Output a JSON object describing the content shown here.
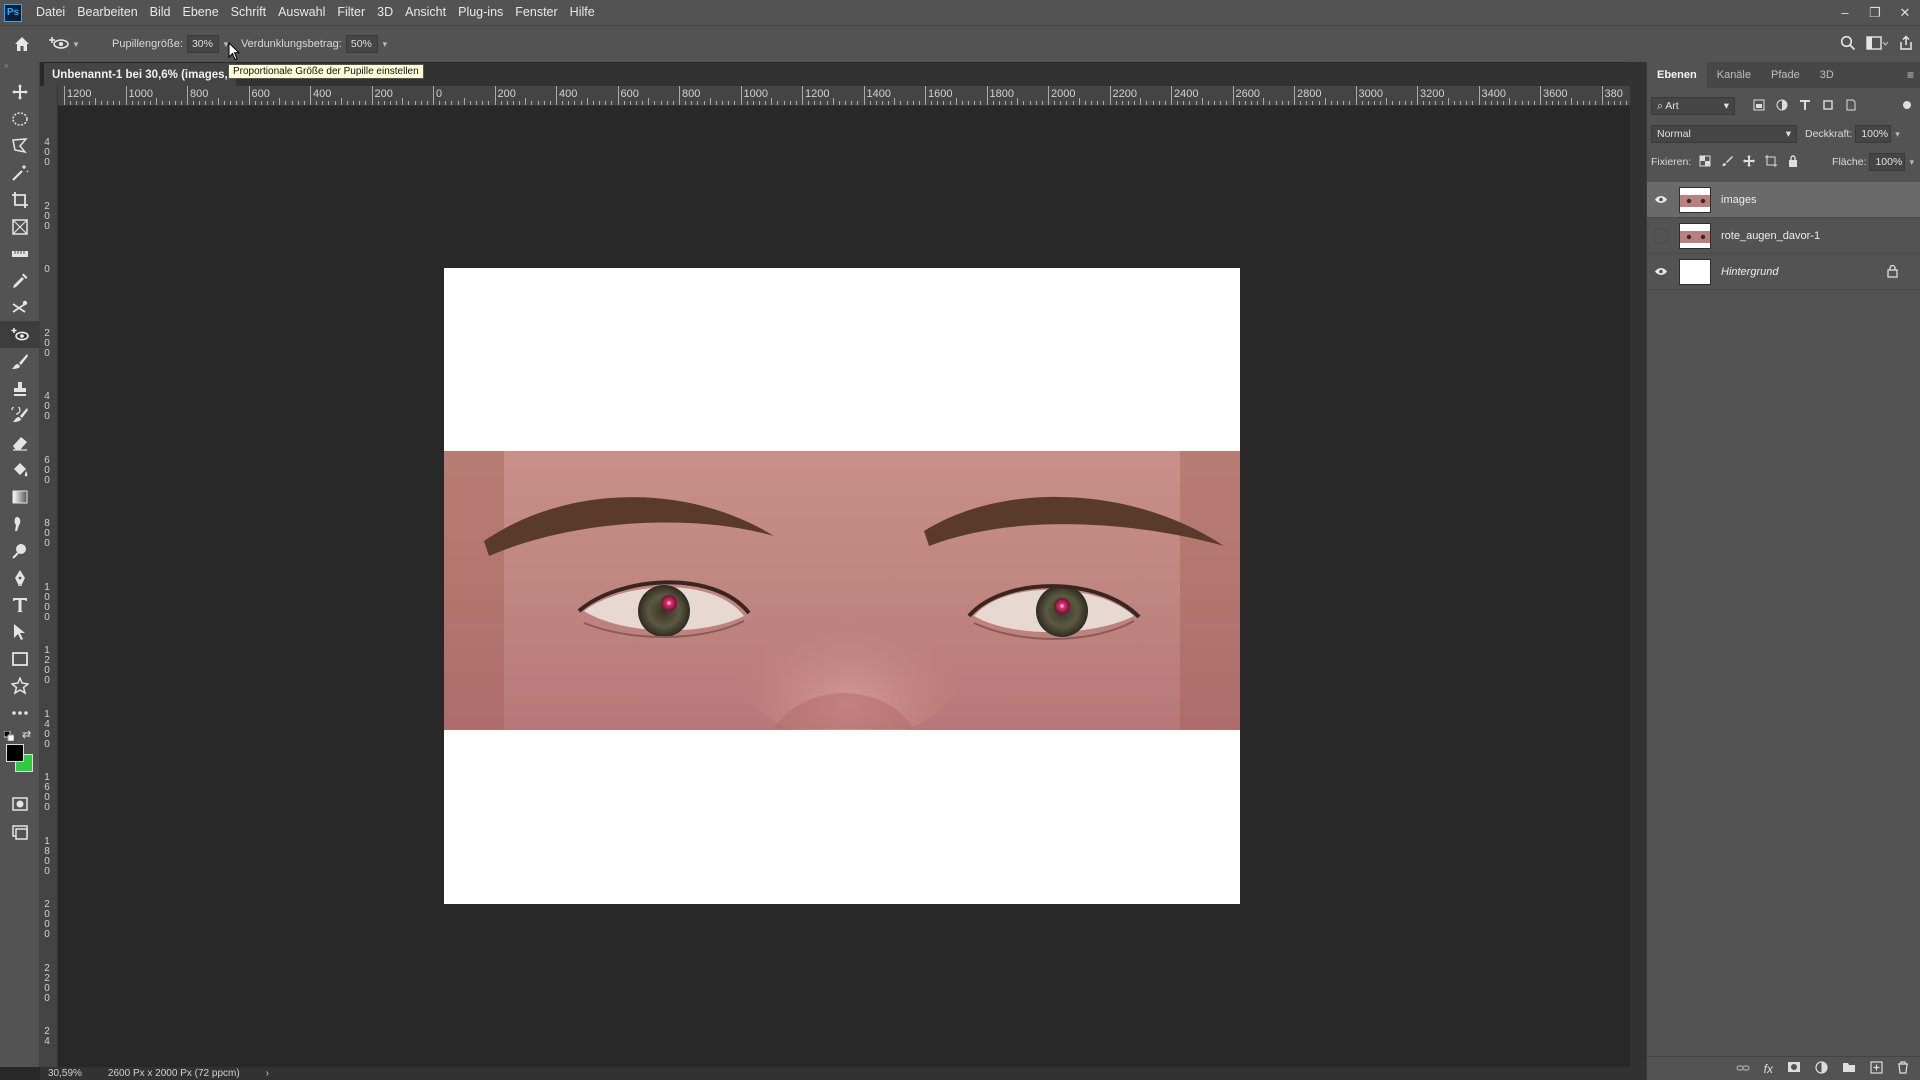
{
  "app": {
    "logo": "Ps"
  },
  "menu": [
    "Datei",
    "Bearbeiten",
    "Bild",
    "Ebene",
    "Schrift",
    "Auswahl",
    "Filter",
    "3D",
    "Ansicht",
    "Plug-ins",
    "Fenster",
    "Hilfe"
  ],
  "window_controls": {
    "minimize": "–",
    "restore": "❐",
    "close": "✕"
  },
  "options": {
    "pupil_label": "Pupillengröße:",
    "pupil_value": "30%",
    "darken_label": "Verdunklungsbetrag:",
    "darken_value": "50%"
  },
  "tooltip": "Proportionale Größe der Pupille einstellen",
  "document_tab": {
    "title": "Unbenannt-1 bei 30,6% (images, "
  },
  "ruler_top": [
    "1200",
    "1000",
    "800",
    "600",
    "400",
    "200",
    "0",
    "200",
    "400",
    "600",
    "800",
    "1000",
    "1200",
    "1400",
    "1600",
    "1800",
    "2000",
    "2200",
    "2400",
    "2600",
    "2800",
    "3000",
    "3200",
    "3400",
    "3600",
    "380"
  ],
  "ruler_left": [
    "4\n0\n0",
    "2\n0\n0",
    "0",
    "2\n0\n0",
    "4\n0\n0",
    "6\n0\n0",
    "8\n0\n0",
    "1\n0\n0\n0",
    "1\n2\n0\n0",
    "1\n4\n0\n0",
    "1\n6\n0\n0",
    "1\n8\n0\n0",
    "2\n0\n0\n0",
    "2\n2\n0\n0",
    "2\n4"
  ],
  "tools": [
    "move-tool",
    "marquee-tool",
    "lasso-tool",
    "magic-wand-tool",
    "crop-tool",
    "frame-tool",
    "ruler-tool",
    "eyedropper-tool",
    "patch-tool",
    "red-eye-tool",
    "brush-tool",
    "stamp-tool",
    "history-brush-tool",
    "eraser-tool",
    "paint-bucket-tool",
    "gradient-tool",
    "smudge-tool",
    "dodge-tool",
    "pen-tool",
    "type-tool",
    "path-select-tool",
    "rectangle-tool",
    "custom-shape-tool",
    "more-tools"
  ],
  "colors": {
    "foreground": "#000000",
    "background": "#2ecc40",
    "accent": "#31a8ff"
  },
  "panel": {
    "tabs": [
      "Ebenen",
      "Kanäle",
      "Pfade",
      "3D"
    ],
    "filter_kind": "Art",
    "blend_mode": "Normal",
    "opacity_label": "Deckkraft:",
    "opacity_value": "100%",
    "lock_label": "Fixieren:",
    "fill_label": "Fläche:",
    "fill_value": "100%",
    "layers": [
      {
        "name": "images",
        "visible": true,
        "selected": true,
        "italic": false,
        "locked": false
      },
      {
        "name": "rote_augen_davor-1",
        "visible": false,
        "selected": false,
        "italic": false,
        "locked": false
      },
      {
        "name": "Hintergrund",
        "visible": true,
        "selected": false,
        "italic": true,
        "locked": true
      }
    ]
  },
  "status": {
    "zoom": "30,59%",
    "doc_info": "2600 Px x 2000 Px (72 ppcm)",
    "arrow": "›"
  }
}
